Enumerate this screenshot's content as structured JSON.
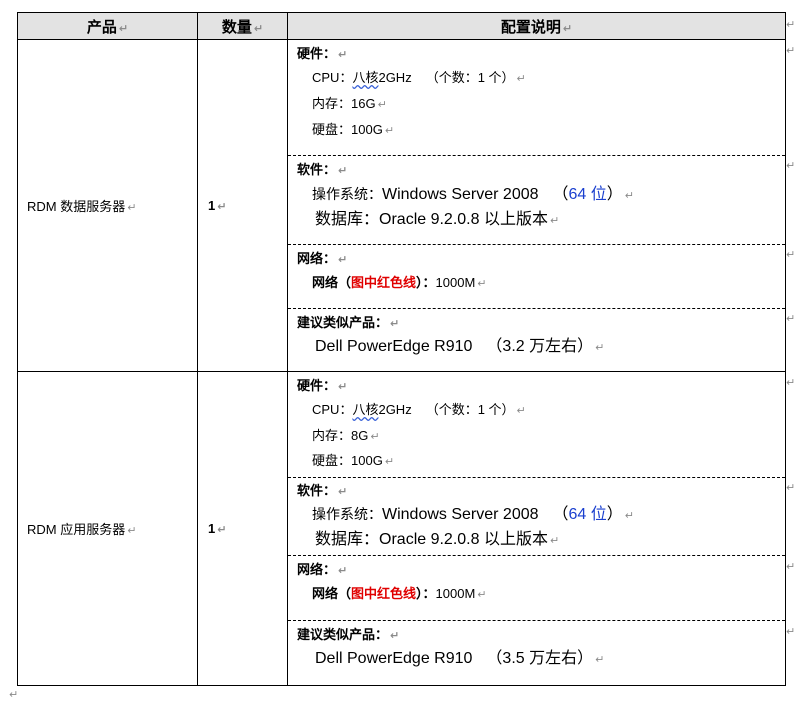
{
  "headers": {
    "product": "产品",
    "qty": "数量",
    "config": "配置说明"
  },
  "mark": "↵",
  "servers": [
    {
      "product": "RDM 数据服务器",
      "qty": "1",
      "hardware_title": "硬件：",
      "cpu_label": "CPU：",
      "cpu_value": "八核",
      "cpu_speed": "2GHz",
      "cpu_count": "（个数：1 个）",
      "mem": "内存：16G",
      "disk": "硬盘：100G",
      "software_title": "软件：",
      "os_label": "操作系统：",
      "os_value": "Windows Server 2008",
      "os_bits_open": "（",
      "os_bits": "64 位",
      "os_bits_close": "）",
      "db_label": "数据库：",
      "db_value": "Oracle 9.2.0.8 以上版本",
      "network_title": "网络：",
      "net_label": "网络（",
      "net_red": "图中红色线",
      "net_close": "）：",
      "net_speed": "1000M",
      "suggest_title": "建议类似产品：",
      "suggest_value": "Dell PowerEdge R910",
      "suggest_price": "（3.2 万左右）"
    },
    {
      "product": "RDM 应用服务器",
      "qty": "1",
      "hardware_title": "硬件：",
      "cpu_label": "CPU：",
      "cpu_value": "八核",
      "cpu_speed": "2GHz",
      "cpu_count": "（个数：1 个）",
      "mem": "内存：8G",
      "disk": "硬盘：100G",
      "software_title": "软件：",
      "os_label": "操作系统：",
      "os_value": "Windows Server 2008",
      "os_bits_open": "（",
      "os_bits": "64 位",
      "os_bits_close": "）",
      "db_label": "数据库：",
      "db_value": "Oracle 9.2.0.8 以上版本",
      "network_title": "网络：",
      "net_label": "网络（",
      "net_red": "图中红色线",
      "net_close": "）：",
      "net_speed": "1000M",
      "suggest_title": "建议类似产品：",
      "suggest_value": "Dell PowerEdge R910",
      "suggest_price": "（3.5 万左右）"
    }
  ]
}
